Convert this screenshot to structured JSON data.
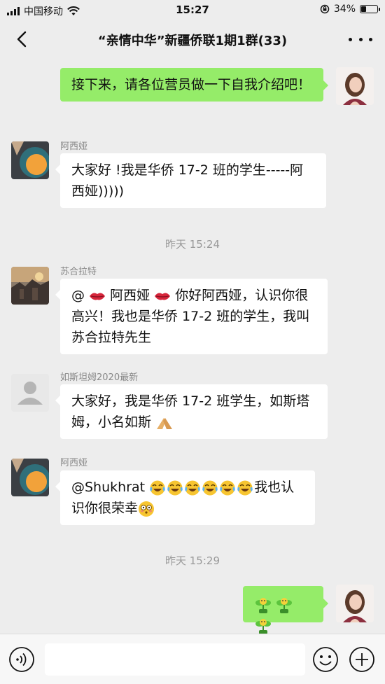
{
  "status_bar": {
    "carrier": "中国移动",
    "time": "15:27",
    "battery_text": "34%",
    "battery_level": 0.34
  },
  "nav": {
    "title": "“亲情中华”新疆侨联1期1群(33)"
  },
  "messages": {
    "m1": {
      "side": "out",
      "text": "接下来，请各位营员做一下自我介绍吧！"
    },
    "m2": {
      "sender": "阿西娅",
      "text": "大家好 !我是华侨 17-2 班的学生-----阿西娅)))))"
    },
    "t1": {
      "text": "昨天 15:24"
    },
    "m3": {
      "sender": "苏合拉特",
      "prefix": "@",
      "name": "阿西娅",
      "text": " 你好阿西娅，认识你很高兴！我也是华侨 17-2 班的学生，我叫苏合拉特先生"
    },
    "m4": {
      "sender": "如斯坦姆2020最新",
      "text": "大家好，我是华侨 17-2 班学生，如斯塔姆，小名如斯 "
    },
    "m5": {
      "sender": "阿西娅",
      "text_a": "@Shukhrat ",
      "text_b": "我也认识你很荣幸"
    },
    "t2": {
      "text": "昨天 15:29"
    }
  },
  "colors": {
    "outgoing_bubble": "#95ec69",
    "incoming_bubble": "#ffffff",
    "background": "#ededed"
  }
}
